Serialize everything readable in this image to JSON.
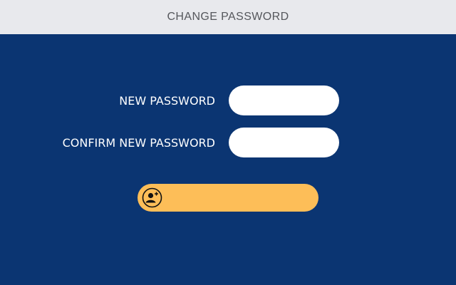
{
  "header": {
    "title": "CHANGE PASSWORD"
  },
  "form": {
    "new_password_label": "NEW PASSWORD",
    "new_password_value": "",
    "confirm_password_label": "CONFIRM NEW PASSWORD",
    "confirm_password_value": "",
    "submit_icon": "add-user-icon"
  },
  "colors": {
    "header_bg": "#e8e9ed",
    "main_bg": "#0b3572",
    "submit_bg": "#fdbe58",
    "field_bg": "#ffffff"
  }
}
